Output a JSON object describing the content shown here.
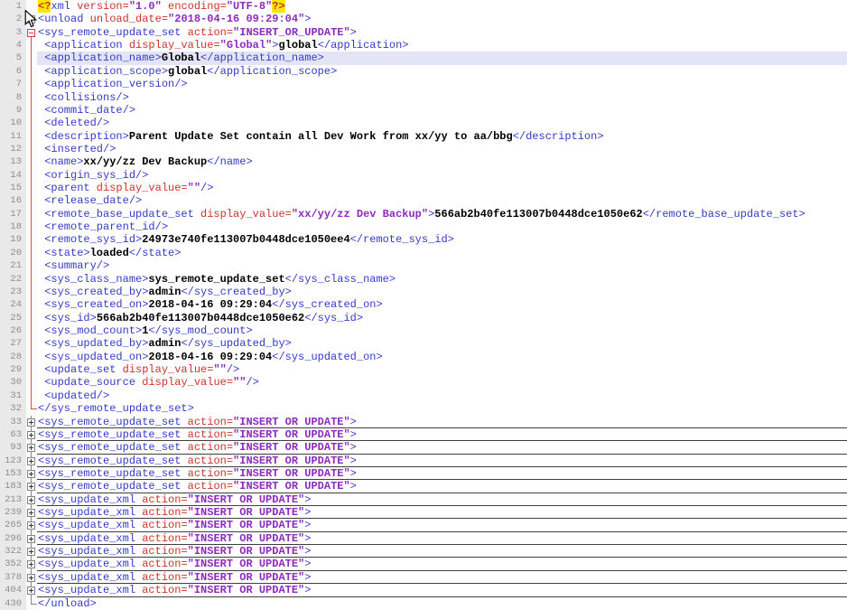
{
  "editor": {
    "language": "xml",
    "colors": {
      "tag": "#333bc7",
      "attribute": "#c9352b",
      "value": "#8c2bbe",
      "text": "#000000",
      "prolog_highlight_bg": "#ffe60a",
      "caret_line_bg": "#e4e4f7",
      "fold_guide_red": "#e14b4b",
      "gutter_bg": "#e9e9e9",
      "gutter_text": "#8e8e8e"
    },
    "rows": [
      {
        "num": "1",
        "fold": "",
        "hl": false,
        "ul": false,
        "segs": [
          [
            "y",
            "<?"
          ],
          [
            "g",
            "xml"
          ],
          [
            "a",
            " version="
          ],
          [
            "v",
            "\"1.0\""
          ],
          [
            "a",
            " encoding="
          ],
          [
            "v",
            "\"UTF-8\""
          ],
          [
            "y",
            "?>"
          ]
        ]
      },
      {
        "num": "2",
        "fold": "minus",
        "hl": false,
        "ul": false,
        "segs": [
          [
            "g",
            "<unload"
          ],
          [
            "a",
            " unload_date="
          ],
          [
            "v",
            "\"2018-04-16 09:29:04\""
          ],
          [
            "g",
            ">"
          ]
        ]
      },
      {
        "num": "3",
        "fold": "minusRed",
        "hl": false,
        "ul": false,
        "segs": [
          [
            "g",
            "<sys_remote_update_set"
          ],
          [
            "a",
            " action="
          ],
          [
            "v",
            "\"INSERT_OR_UPDATE\""
          ],
          [
            "g",
            ">"
          ]
        ]
      },
      {
        "num": "4",
        "fold": "lineRed",
        "hl": false,
        "ul": false,
        "segs": [
          [
            "g",
            " <application"
          ],
          [
            "a",
            " display_value="
          ],
          [
            "v",
            "\"Global\""
          ],
          [
            "g",
            ">"
          ],
          [
            "t",
            "global"
          ],
          [
            "g",
            "</application>"
          ]
        ]
      },
      {
        "num": "5",
        "fold": "lineRed",
        "hl": true,
        "ul": false,
        "segs": [
          [
            "g",
            " <application_name>"
          ],
          [
            "t",
            "Global"
          ],
          [
            "g",
            "</application_name>"
          ]
        ]
      },
      {
        "num": "6",
        "fold": "lineRed",
        "hl": false,
        "ul": false,
        "segs": [
          [
            "g",
            " <application_scope>"
          ],
          [
            "t",
            "global"
          ],
          [
            "g",
            "</application_scope>"
          ]
        ]
      },
      {
        "num": "7",
        "fold": "lineRed",
        "hl": false,
        "ul": false,
        "segs": [
          [
            "g",
            " <application_version/>"
          ]
        ]
      },
      {
        "num": "8",
        "fold": "lineRed",
        "hl": false,
        "ul": false,
        "segs": [
          [
            "g",
            " <collisions/>"
          ]
        ]
      },
      {
        "num": "9",
        "fold": "lineRed",
        "hl": false,
        "ul": false,
        "segs": [
          [
            "g",
            " <commit_date/>"
          ]
        ]
      },
      {
        "num": "10",
        "fold": "lineRed",
        "hl": false,
        "ul": false,
        "segs": [
          [
            "g",
            " <deleted/>"
          ]
        ]
      },
      {
        "num": "11",
        "fold": "lineRed",
        "hl": false,
        "ul": false,
        "segs": [
          [
            "g",
            " <description>"
          ],
          [
            "t",
            "Parent Update Set contain all Dev Work from xx/yy to aa/bbg"
          ],
          [
            "g",
            "</description>"
          ]
        ]
      },
      {
        "num": "12",
        "fold": "lineRed",
        "hl": false,
        "ul": false,
        "segs": [
          [
            "g",
            " <inserted/>"
          ]
        ]
      },
      {
        "num": "13",
        "fold": "lineRed",
        "hl": false,
        "ul": false,
        "segs": [
          [
            "g",
            " <name>"
          ],
          [
            "t",
            "xx/yy/zz Dev Backup"
          ],
          [
            "g",
            "</name>"
          ]
        ]
      },
      {
        "num": "14",
        "fold": "lineRed",
        "hl": false,
        "ul": false,
        "segs": [
          [
            "g",
            " <origin_sys_id/>"
          ]
        ]
      },
      {
        "num": "15",
        "fold": "lineRed",
        "hl": false,
        "ul": false,
        "segs": [
          [
            "g",
            " <parent"
          ],
          [
            "a",
            " display_value="
          ],
          [
            "v",
            "\"\""
          ],
          [
            "g",
            "/>"
          ]
        ]
      },
      {
        "num": "16",
        "fold": "lineRed",
        "hl": false,
        "ul": false,
        "segs": [
          [
            "g",
            " <release_date/>"
          ]
        ]
      },
      {
        "num": "17",
        "fold": "lineRed",
        "hl": false,
        "ul": false,
        "segs": [
          [
            "g",
            " <remote_base_update_set"
          ],
          [
            "a",
            " display_value="
          ],
          [
            "v",
            "\"xx/yy/zz Dev Backup\""
          ],
          [
            "g",
            ">"
          ],
          [
            "t",
            "566ab2b40fe113007b0448dce1050e62"
          ],
          [
            "g",
            "</remote_base_update_set>"
          ]
        ]
      },
      {
        "num": "18",
        "fold": "lineRed",
        "hl": false,
        "ul": false,
        "segs": [
          [
            "g",
            " <remote_parent_id/>"
          ]
        ]
      },
      {
        "num": "19",
        "fold": "lineRed",
        "hl": false,
        "ul": false,
        "segs": [
          [
            "g",
            " <remote_sys_id>"
          ],
          [
            "t",
            "24973e740fe113007b0448dce1050ee4"
          ],
          [
            "g",
            "</remote_sys_id>"
          ]
        ]
      },
      {
        "num": "20",
        "fold": "lineRed",
        "hl": false,
        "ul": false,
        "segs": [
          [
            "g",
            " <state>"
          ],
          [
            "t",
            "loaded"
          ],
          [
            "g",
            "</state>"
          ]
        ]
      },
      {
        "num": "21",
        "fold": "lineRed",
        "hl": false,
        "ul": false,
        "segs": [
          [
            "g",
            " <summary/>"
          ]
        ]
      },
      {
        "num": "22",
        "fold": "lineRed",
        "hl": false,
        "ul": false,
        "segs": [
          [
            "g",
            " <sys_class_name>"
          ],
          [
            "t",
            "sys_remote_update_set"
          ],
          [
            "g",
            "</sys_class_name>"
          ]
        ]
      },
      {
        "num": "23",
        "fold": "lineRed",
        "hl": false,
        "ul": false,
        "segs": [
          [
            "g",
            " <sys_created_by>"
          ],
          [
            "t",
            "admin"
          ],
          [
            "g",
            "</sys_created_by>"
          ]
        ]
      },
      {
        "num": "24",
        "fold": "lineRed",
        "hl": false,
        "ul": false,
        "segs": [
          [
            "g",
            " <sys_created_on>"
          ],
          [
            "t",
            "2018-04-16 09:29:04"
          ],
          [
            "g",
            "</sys_created_on>"
          ]
        ]
      },
      {
        "num": "25",
        "fold": "lineRed",
        "hl": false,
        "ul": false,
        "segs": [
          [
            "g",
            " <sys_id>"
          ],
          [
            "t",
            "566ab2b40fe113007b0448dce1050e62"
          ],
          [
            "g",
            "</sys_id>"
          ]
        ]
      },
      {
        "num": "26",
        "fold": "lineRed",
        "hl": false,
        "ul": false,
        "segs": [
          [
            "g",
            " <sys_mod_count>"
          ],
          [
            "t",
            "1"
          ],
          [
            "g",
            "</sys_mod_count>"
          ]
        ]
      },
      {
        "num": "27",
        "fold": "lineRed",
        "hl": false,
        "ul": false,
        "segs": [
          [
            "g",
            " <sys_updated_by>"
          ],
          [
            "t",
            "admin"
          ],
          [
            "g",
            "</sys_updated_by>"
          ]
        ]
      },
      {
        "num": "28",
        "fold": "lineRed",
        "hl": false,
        "ul": false,
        "segs": [
          [
            "g",
            " <sys_updated_on>"
          ],
          [
            "t",
            "2018-04-16 09:29:04"
          ],
          [
            "g",
            "</sys_updated_on>"
          ]
        ]
      },
      {
        "num": "29",
        "fold": "lineRed",
        "hl": false,
        "ul": false,
        "segs": [
          [
            "g",
            " <update_set"
          ],
          [
            "a",
            " display_value="
          ],
          [
            "v",
            "\"\""
          ],
          [
            "g",
            "/>"
          ]
        ]
      },
      {
        "num": "30",
        "fold": "lineRed",
        "hl": false,
        "ul": false,
        "segs": [
          [
            "g",
            " <update_source"
          ],
          [
            "a",
            " display_value="
          ],
          [
            "v",
            "\"\""
          ],
          [
            "g",
            "/>"
          ]
        ]
      },
      {
        "num": "31",
        "fold": "lineRed",
        "hl": false,
        "ul": false,
        "segs": [
          [
            "g",
            " <updated/>"
          ]
        ]
      },
      {
        "num": "32",
        "fold": "endRed",
        "hl": false,
        "ul": false,
        "segs": [
          [
            "g",
            "</sys_remote_update_set>"
          ]
        ]
      },
      {
        "num": "33",
        "fold": "plus",
        "hl": false,
        "ul": true,
        "segs": [
          [
            "g",
            "<sys_remote_update_set"
          ],
          [
            "a",
            " action="
          ],
          [
            "v",
            "\"INSERT OR UPDATE\""
          ],
          [
            "g",
            ">"
          ]
        ]
      },
      {
        "num": "63",
        "fold": "plus",
        "hl": false,
        "ul": true,
        "segs": [
          [
            "g",
            "<sys_remote_update_set"
          ],
          [
            "a",
            " action="
          ],
          [
            "v",
            "\"INSERT OR UPDATE\""
          ],
          [
            "g",
            ">"
          ]
        ]
      },
      {
        "num": "93",
        "fold": "plus",
        "hl": false,
        "ul": true,
        "segs": [
          [
            "g",
            "<sys_remote_update_set"
          ],
          [
            "a",
            " action="
          ],
          [
            "v",
            "\"INSERT OR UPDATE\""
          ],
          [
            "g",
            ">"
          ]
        ]
      },
      {
        "num": "123",
        "fold": "plus",
        "hl": false,
        "ul": true,
        "segs": [
          [
            "g",
            "<sys_remote_update_set"
          ],
          [
            "a",
            " action="
          ],
          [
            "v",
            "\"INSERT OR UPDATE\""
          ],
          [
            "g",
            ">"
          ]
        ]
      },
      {
        "num": "153",
        "fold": "plus",
        "hl": false,
        "ul": true,
        "segs": [
          [
            "g",
            "<sys_remote_update_set"
          ],
          [
            "a",
            " action="
          ],
          [
            "v",
            "\"INSERT OR UPDATE\""
          ],
          [
            "g",
            ">"
          ]
        ]
      },
      {
        "num": "183",
        "fold": "plus",
        "hl": false,
        "ul": true,
        "segs": [
          [
            "g",
            "<sys_remote_update_set"
          ],
          [
            "a",
            " action="
          ],
          [
            "v",
            "\"INSERT OR UPDATE\""
          ],
          [
            "g",
            ">"
          ]
        ]
      },
      {
        "num": "213",
        "fold": "plus",
        "hl": false,
        "ul": true,
        "segs": [
          [
            "g",
            "<sys_update_xml"
          ],
          [
            "a",
            " action="
          ],
          [
            "v",
            "\"INSERT OR UPDATE\""
          ],
          [
            "g",
            ">"
          ]
        ]
      },
      {
        "num": "239",
        "fold": "plus",
        "hl": false,
        "ul": true,
        "segs": [
          [
            "g",
            "<sys_update_xml"
          ],
          [
            "a",
            " action="
          ],
          [
            "v",
            "\"INSERT OR UPDATE\""
          ],
          [
            "g",
            ">"
          ]
        ]
      },
      {
        "num": "265",
        "fold": "plus",
        "hl": false,
        "ul": true,
        "segs": [
          [
            "g",
            "<sys_update_xml"
          ],
          [
            "a",
            " action="
          ],
          [
            "v",
            "\"INSERT OR UPDATE\""
          ],
          [
            "g",
            ">"
          ]
        ]
      },
      {
        "num": "296",
        "fold": "plus",
        "hl": false,
        "ul": true,
        "segs": [
          [
            "g",
            "<sys_update_xml"
          ],
          [
            "a",
            " action="
          ],
          [
            "v",
            "\"INSERT OR UPDATE\""
          ],
          [
            "g",
            ">"
          ]
        ]
      },
      {
        "num": "322",
        "fold": "plus",
        "hl": false,
        "ul": true,
        "segs": [
          [
            "g",
            "<sys_update_xml"
          ],
          [
            "a",
            " action="
          ],
          [
            "v",
            "\"INSERT OR UPDATE\""
          ],
          [
            "g",
            ">"
          ]
        ]
      },
      {
        "num": "352",
        "fold": "plus",
        "hl": false,
        "ul": true,
        "segs": [
          [
            "g",
            "<sys_update_xml"
          ],
          [
            "a",
            " action="
          ],
          [
            "v",
            "\"INSERT OR UPDATE\""
          ],
          [
            "g",
            ">"
          ]
        ]
      },
      {
        "num": "378",
        "fold": "plus",
        "hl": false,
        "ul": true,
        "segs": [
          [
            "g",
            "<sys_update_xml"
          ],
          [
            "a",
            " action="
          ],
          [
            "v",
            "\"INSERT OR UPDATE\""
          ],
          [
            "g",
            ">"
          ]
        ]
      },
      {
        "num": "404",
        "fold": "plus",
        "hl": false,
        "ul": true,
        "segs": [
          [
            "g",
            "<sys_update_xml"
          ],
          [
            "a",
            " action="
          ],
          [
            "v",
            "\"INSERT OR UPDATE\""
          ],
          [
            "g",
            ">"
          ]
        ]
      },
      {
        "num": "430",
        "fold": "end",
        "hl": false,
        "ul": false,
        "segs": [
          [
            "g",
            "</unload>"
          ]
        ]
      }
    ]
  }
}
